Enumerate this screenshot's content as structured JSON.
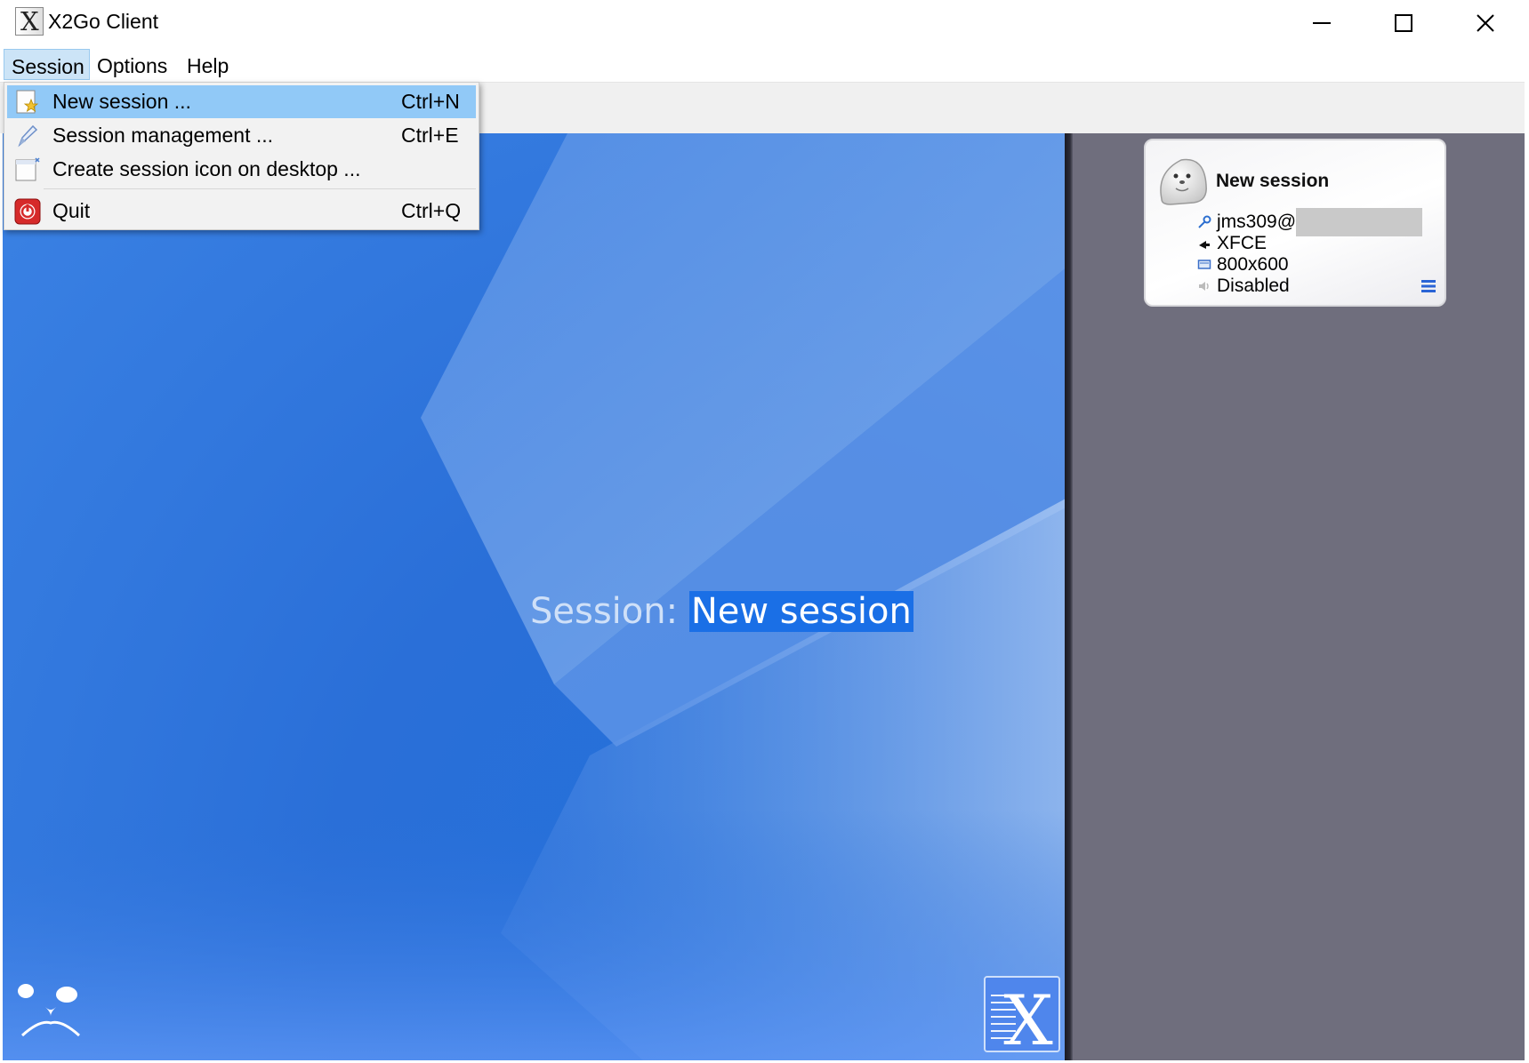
{
  "window": {
    "title": "X2Go Client",
    "logo_glyph": "X",
    "controls": {
      "minimize": "minimize-icon",
      "maximize": "maximize-icon",
      "close": "close-icon"
    }
  },
  "menubar": {
    "items": [
      {
        "label": "Session",
        "open": true
      },
      {
        "label": "Options"
      },
      {
        "label": "Help"
      }
    ]
  },
  "session_menu": {
    "items": [
      {
        "label": "New session ...",
        "shortcut": "Ctrl+N",
        "icon": "new-session-icon",
        "highlighted": true
      },
      {
        "label": "Session management ...",
        "shortcut": "Ctrl+E",
        "icon": "pencil-icon"
      },
      {
        "label": "Create session icon on desktop ...",
        "shortcut": "",
        "icon": "desktop-shortcut-icon"
      },
      {
        "label": "Quit",
        "shortcut": "Ctrl+Q",
        "icon": "power-icon"
      }
    ]
  },
  "main": {
    "caption_prefix": "Session: ",
    "caption_name": "New session"
  },
  "session_card": {
    "title": "New session",
    "user": "jms309@",
    "desktop": "XFCE",
    "resolution": "800x600",
    "sound": "Disabled"
  },
  "colors": {
    "menu_highlight": "#91c9f7",
    "main_panel_blue": "#2a6fd8",
    "right_panel_gray": "#6f6e7d",
    "caption_highlight": "#1a6fe6"
  }
}
